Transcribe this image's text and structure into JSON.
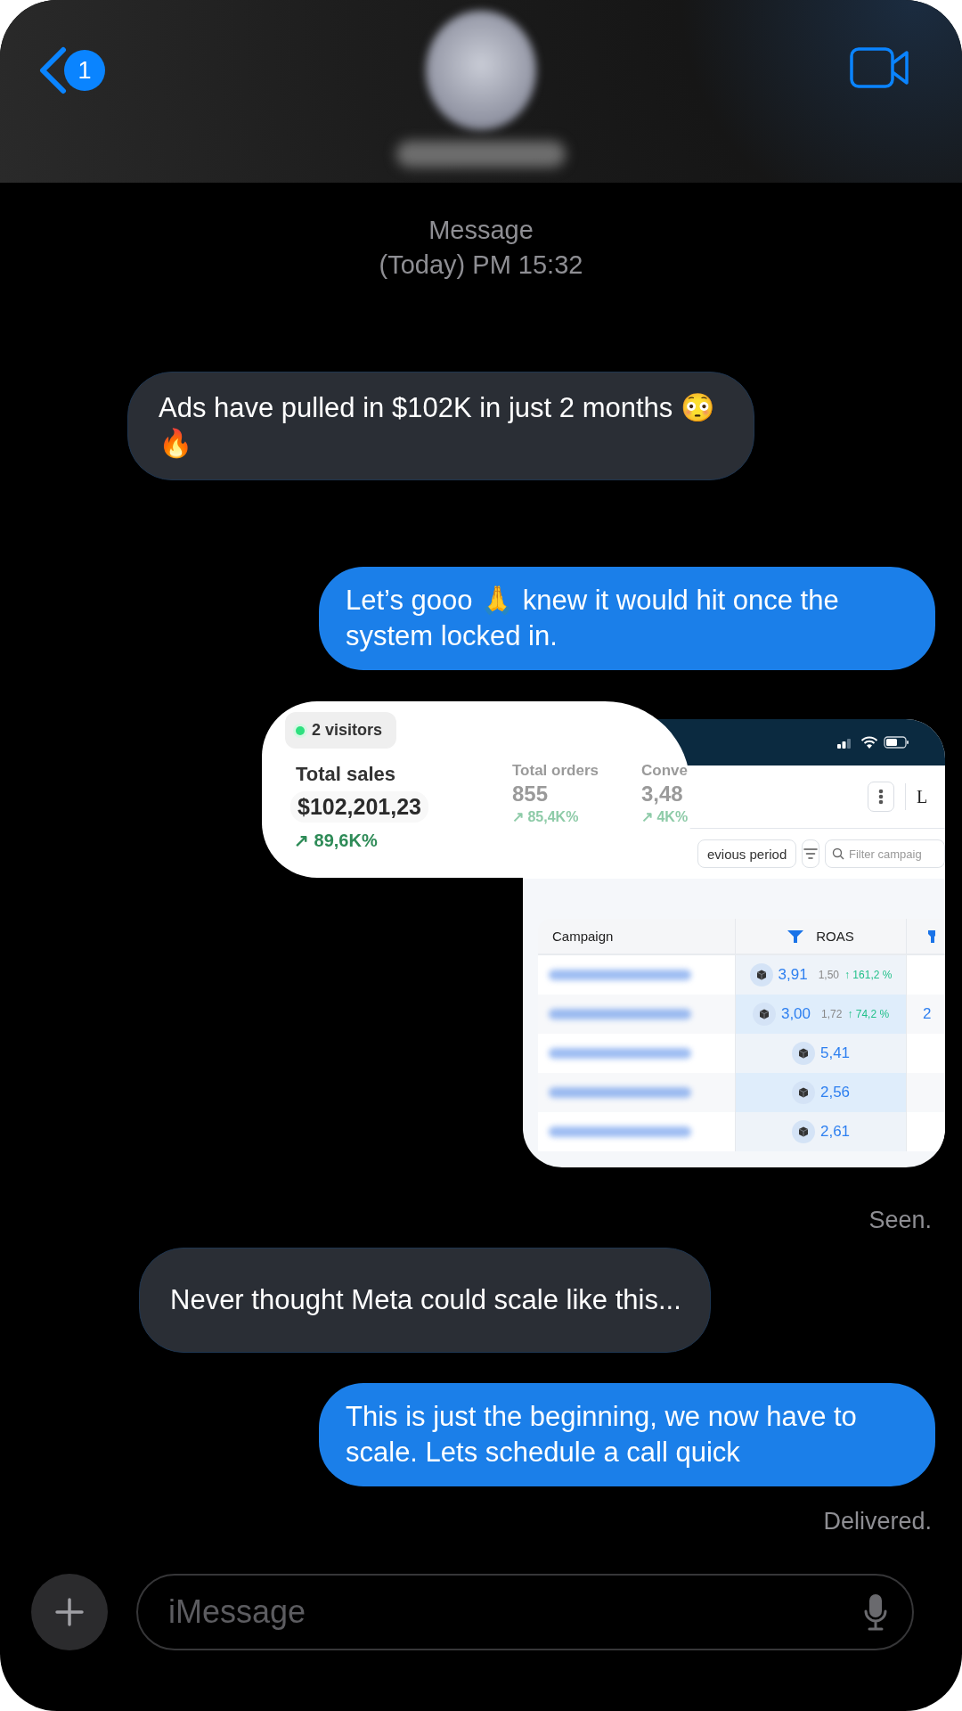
{
  "header": {
    "back_badge": "1"
  },
  "timestamp": {
    "label": "Message",
    "time": "(Today) PM 15:32"
  },
  "messages": [
    {
      "kind": "text",
      "outgoing": false,
      "text": "Ads have pulled in $102K in just 2 months 😳🔥"
    },
    {
      "kind": "text",
      "outgoing": true,
      "text": "Let’s gooo 🙏 knew it would hit once the system locked in."
    },
    {
      "kind": "image",
      "outgoing": true,
      "summary_card": {
        "visitors": "2 visitors",
        "total_sales": {
          "label": "Total sales",
          "value": "$102,201,23",
          "change": "↗ 89,6K%"
        },
        "metrics": [
          {
            "label": "Total orders",
            "value": "855",
            "change": "↗ 85,4K%"
          },
          {
            "label": "Conve",
            "value": "3,48",
            "change": "↗ 4K%"
          }
        ]
      },
      "dashboard": {
        "header_initial": "L",
        "period_button": "evious period",
        "search": {
          "placeholder": "Filter campaig"
        },
        "table": {
          "columns": [
            "Campaign",
            "ROAS"
          ],
          "rows": [
            {
              "roas": "3,91",
              "previous": "1,50",
              "change": "↑ 161,2 %"
            },
            {
              "roas": "3,00",
              "previous": "1,72",
              "change": "↑ 74,2 %",
              "column_3": "2"
            },
            {
              "roas": "5,41"
            },
            {
              "roas": "2,56"
            },
            {
              "roas": "2,61"
            }
          ]
        }
      }
    },
    {
      "kind": "status",
      "text": "Seen."
    },
    {
      "kind": "text",
      "outgoing": false,
      "text": "Never thought Meta could scale like this..."
    },
    {
      "kind": "text",
      "outgoing": true,
      "text": "This is just the beginning, we now have to scale. Lets schedule a call quick"
    },
    {
      "kind": "status",
      "text": "Delivered."
    }
  ],
  "composer": {
    "placeholder": "iMessage"
  }
}
